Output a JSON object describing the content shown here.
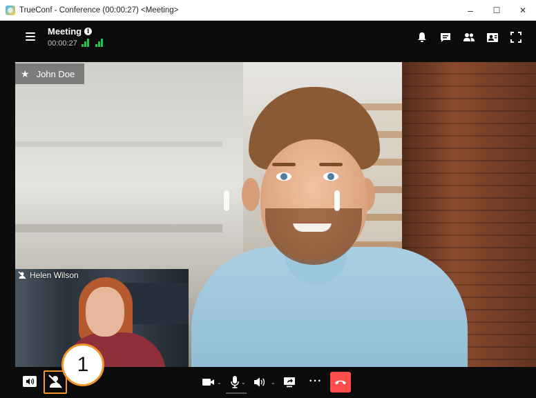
{
  "window": {
    "title": "TrueConf - Conference (00:00:27) <Meeting>",
    "minimize_label": "–",
    "maximize_label": "☐",
    "close_label": "✕"
  },
  "header": {
    "title": "Meeting",
    "timer": "00:00:27",
    "info_glyph": "i",
    "icons": [
      "bell-icon",
      "chat-icon",
      "participants-icon",
      "layout-icon",
      "fullscreen-icon"
    ]
  },
  "main_video": {
    "participant_name": "John Doe",
    "star_glyph": "★"
  },
  "self_view": {
    "participant_name": "Helen Wilson"
  },
  "controls": {
    "chevron_glyph": "⌄",
    "more_glyph": "···",
    "icons": [
      "speaker-icon",
      "self-view-icon",
      "camera-icon",
      "microphone-icon",
      "volume-icon",
      "share-screen-icon",
      "more-icon",
      "hang-up-icon"
    ]
  },
  "callout": {
    "number": "1",
    "color": "#f0962d"
  },
  "colors": {
    "signal_good": "#27c24c",
    "hang_up": "#ff4d4d",
    "bar_background": "#0b0b0b"
  }
}
